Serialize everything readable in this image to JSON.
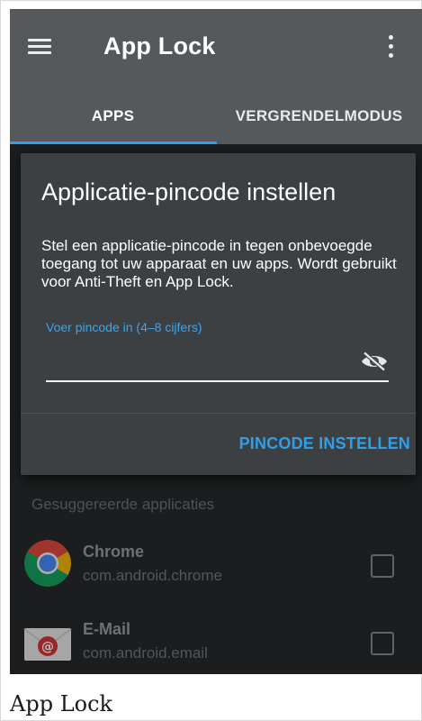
{
  "app": {
    "title": "App Lock"
  },
  "tabs": [
    {
      "label": "APPS",
      "selected": true
    },
    {
      "label": "VERGRENDELMODUS",
      "selected": false
    }
  ],
  "dialog": {
    "title": "Applicatie-pincode instellen",
    "body": "Stel een applicatie-pincode in tegen onbevoegde toegang tot uw apparaat en uw apps. Wordt gebruikt voor Anti-Theft en App Lock.",
    "hint": "Voer pincode in (4–8 cijfers)",
    "pin_value": "",
    "action_label": "PINCODE INSTELLEN"
  },
  "list": {
    "section_header": "Gesuggereerde applicaties",
    "apps": [
      {
        "name": "Chrome",
        "package": "com.android.chrome",
        "icon": "chrome-icon",
        "checked": false
      },
      {
        "name": "E-Mail",
        "package": "com.android.email",
        "icon": "email-icon",
        "checked": false
      }
    ]
  },
  "caption": "App Lock",
  "colors": {
    "toolbar": "#55595c",
    "accent": "#2f9fe8",
    "dialog": "#3c4043",
    "background": "#1f2224"
  }
}
